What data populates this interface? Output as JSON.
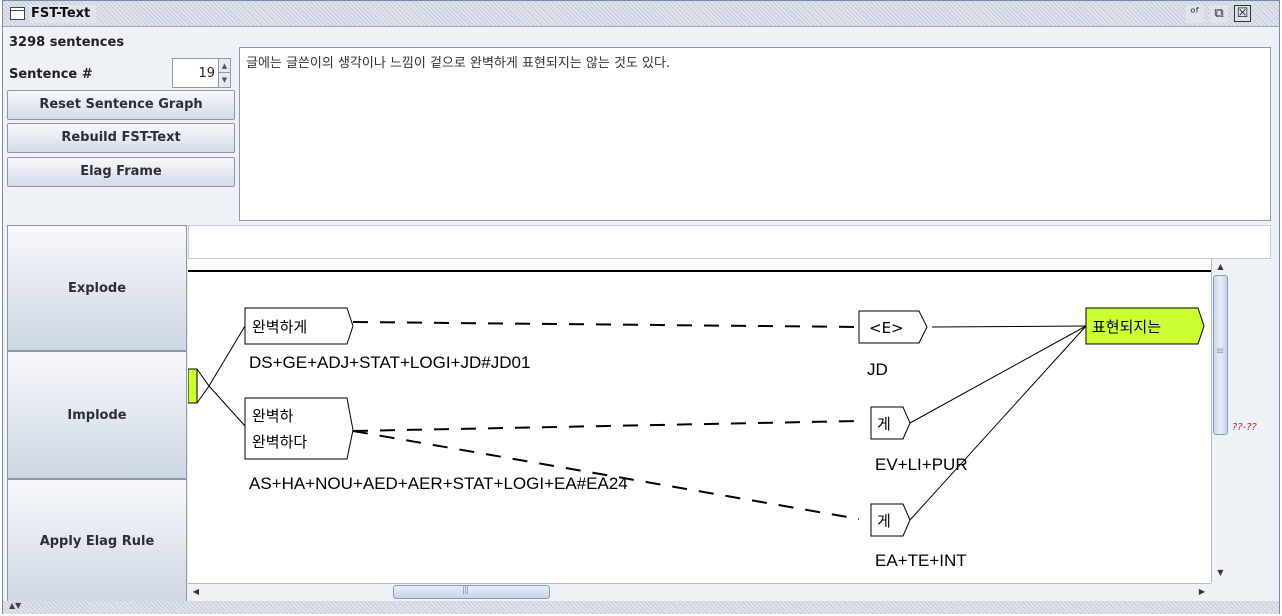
{
  "window": {
    "title": "FST-Text",
    "min_icon": "ᵒᶠ",
    "max_icon": "⧉",
    "close_icon": "☒"
  },
  "controls": {
    "sentence_count": "3298 sentences",
    "sentence_label": "Sentence #",
    "sentence_number": "19",
    "reset_label": "Reset Sentence Graph",
    "rebuild_label": "Rebuild FST-Text",
    "elag_label": "Elag Frame"
  },
  "sentence_text": "글에는 글쓴이의 생각이나 느낌이 겉으로 완벽하게 표현되지는 않는 것도 있다.",
  "actions": {
    "explode_label": "Explode",
    "implode_label": "Implode",
    "apply_label": "Apply Elag Rule"
  },
  "graph": {
    "nodes": [
      {
        "id": "n1",
        "lines": [
          "완벽하게"
        ],
        "output": "DS+GE+ADJ+STAT+LOGI+JD#JD01"
      },
      {
        "id": "n2",
        "lines": [
          "완벽하",
          "완벽하다"
        ],
        "output": "AS+HA+NOU+AED+AER+STAT+LOGI+EA#EA24"
      },
      {
        "id": "n3",
        "lines": [
          "<E>"
        ],
        "output": "JD"
      },
      {
        "id": "n4",
        "lines": [
          "게"
        ],
        "output": "EV+LI+PUR"
      },
      {
        "id": "n5",
        "lines": [
          "게"
        ],
        "output": "EA+TE+INT"
      },
      {
        "id": "n6",
        "lines": [
          "표현되지는"
        ],
        "output": "",
        "highlight": "#ccff33"
      }
    ]
  },
  "scroll": {
    "range_label": "??-??"
  }
}
